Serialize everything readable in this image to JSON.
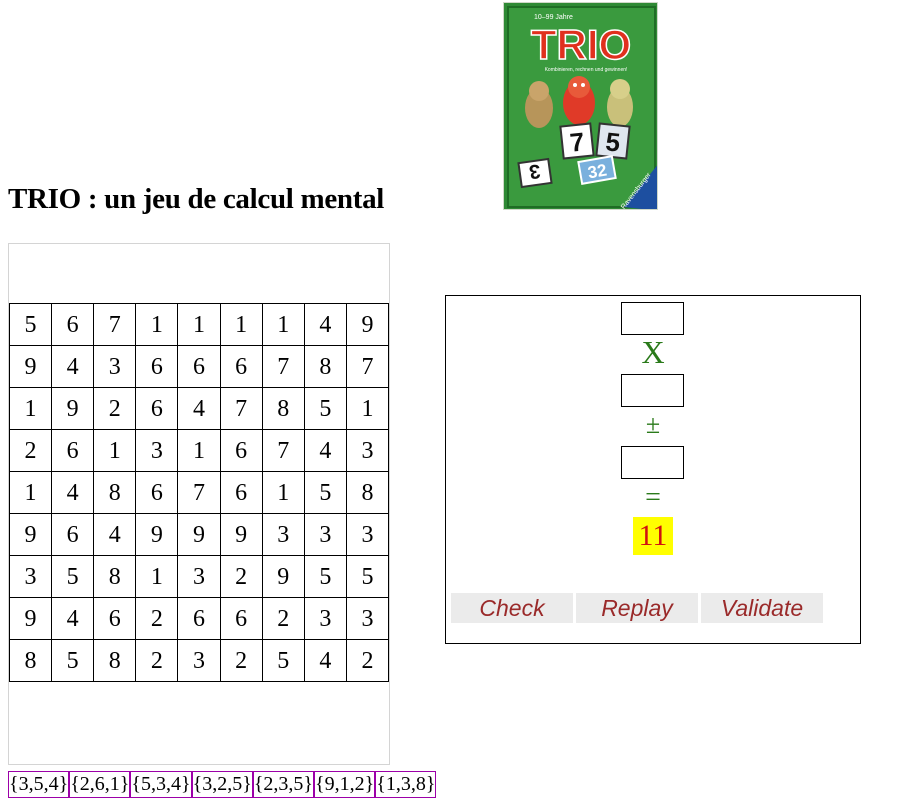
{
  "header": {
    "title": "TRIO : un jeu de calcul mental",
    "box": {
      "age_text": "10–99 Jahre",
      "brand": "TRIO",
      "tagline": "Kombinieren, rechnen und gewinnen!",
      "publisher": "Ravensburger",
      "tile_a": "7",
      "tile_b": "5",
      "tile_c": "3",
      "tile_d": "32"
    }
  },
  "grid": {
    "rows": [
      [
        "5",
        "6",
        "7",
        "1",
        "1",
        "1",
        "1",
        "4",
        "9"
      ],
      [
        "9",
        "4",
        "3",
        "6",
        "6",
        "6",
        "7",
        "8",
        "7"
      ],
      [
        "1",
        "9",
        "2",
        "6",
        "4",
        "7",
        "8",
        "5",
        "1"
      ],
      [
        "2",
        "6",
        "1",
        "3",
        "1",
        "6",
        "7",
        "4",
        "3"
      ],
      [
        "1",
        "4",
        "8",
        "6",
        "7",
        "6",
        "1",
        "5",
        "8"
      ],
      [
        "9",
        "6",
        "4",
        "9",
        "9",
        "9",
        "3",
        "3",
        "3"
      ],
      [
        "3",
        "5",
        "8",
        "1",
        "3",
        "2",
        "9",
        "5",
        "5"
      ],
      [
        "9",
        "4",
        "6",
        "2",
        "6",
        "6",
        "2",
        "3",
        "3"
      ],
      [
        "8",
        "5",
        "8",
        "2",
        "3",
        "2",
        "5",
        "4",
        "2"
      ]
    ]
  },
  "calculator": {
    "slot1_value": "",
    "slot2_value": "",
    "slot3_value": "",
    "multiply_op": "X",
    "plusminus_op": "±",
    "equals_op": "=",
    "target": "11",
    "buttons": {
      "check": "Check",
      "replay": "Replay",
      "validate": "Validate"
    }
  },
  "trios": [
    "{3,5,4}",
    "{2,6,1}",
    "{5,3,4}",
    "{3,2,5}",
    "{2,3,5}",
    "{9,1,2}",
    "{1,3,8}"
  ],
  "colors": {
    "operator": "#2a7a1a",
    "target_bg": "#ffff00",
    "target_fg": "#d01010",
    "button_text": "#9a2a2a",
    "button_bg": "#ebebeb",
    "chip_border": "#9c00a8"
  }
}
